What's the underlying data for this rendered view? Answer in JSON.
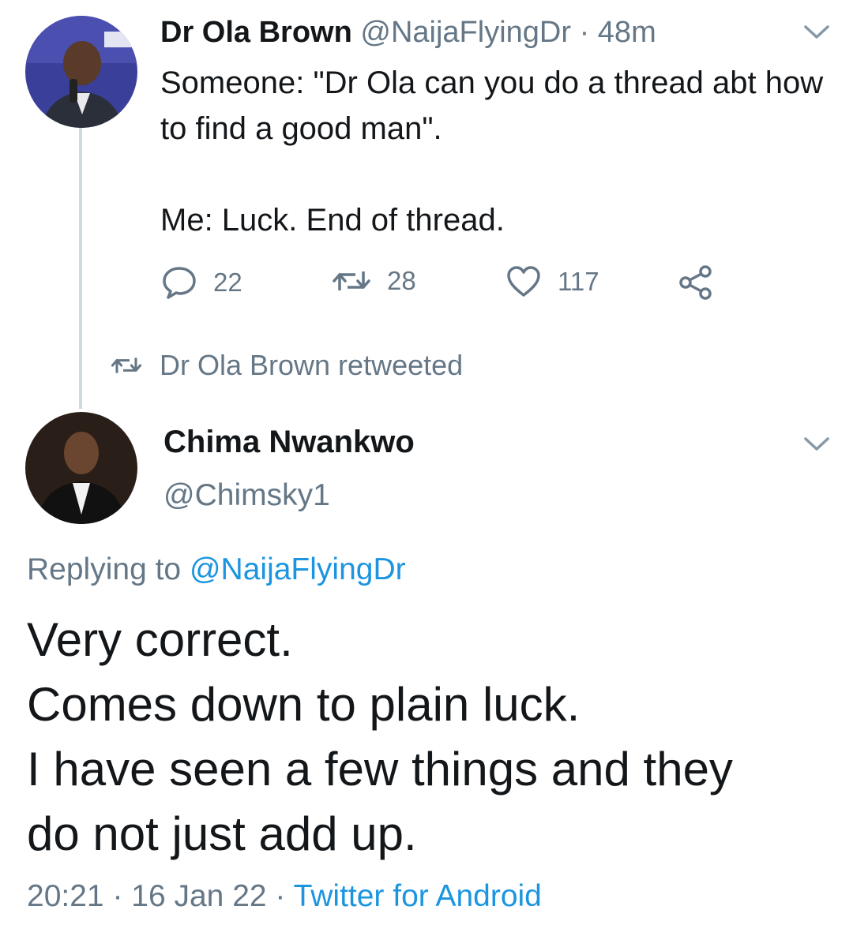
{
  "tweet1": {
    "author_name": "Dr Ola Brown",
    "handle": "@NaijaFlyingDr",
    "separator": " · ",
    "time_ago": "48m",
    "body": "Someone: \"Dr Ola can you do a thread abt how to find a good man\".\n\nMe: Luck. End of thread.",
    "replies": "22",
    "retweets": "28",
    "likes": "117"
  },
  "retweet_context": {
    "text": "Dr Ola Brown retweeted"
  },
  "tweet2": {
    "author_name": "Chima Nwankwo",
    "handle": "@Chimsky1",
    "replying_prefix": "Replying to ",
    "replying_to": "@NaijaFlyingDr",
    "body_lines": [
      "Very correct.",
      "Comes down to plain luck.",
      "I have seen a few things and they",
      "do not just add up."
    ],
    "time": "20:21",
    "sep1": " · ",
    "date": "16 Jan 22",
    "sep2": " · ",
    "client": "Twitter for Android"
  },
  "icons": {
    "reply": "speech-bubble-icon",
    "retweet": "retweet-arrows-icon",
    "like": "heart-outline-icon",
    "share": "share-nodes-icon",
    "more": "chevron-down-icon"
  },
  "colors": {
    "text_primary": "#14171a",
    "text_secondary": "#657786",
    "link": "#1b95e0",
    "thread_line": "#cfd9de"
  }
}
